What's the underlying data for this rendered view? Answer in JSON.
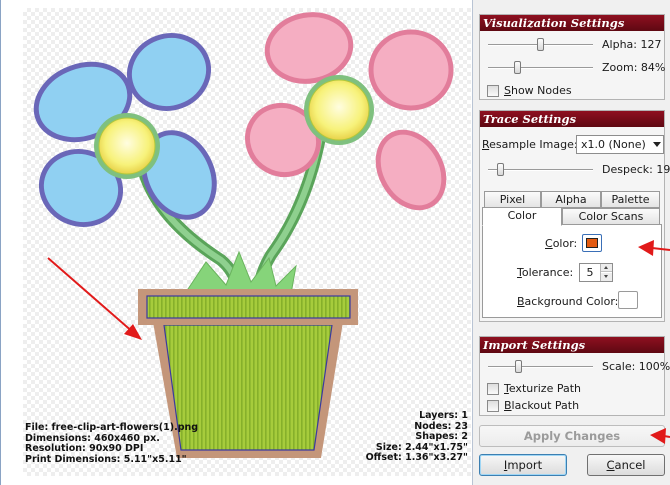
{
  "colors": {
    "panel_title_bg": "#8e1020",
    "annotation_arrow": "#e11a1a",
    "selected_trace_color": "#e35a10",
    "pot_fill": "#9cc53a",
    "pot_rim": "#c4967a",
    "petal_blue": "#8fd0f2",
    "petal_pink": "#f2a8be",
    "flower_center": "#f5f07a",
    "stem_green": "#7ac47a"
  },
  "canvas": {
    "file_info": {
      "file": "File: free-clip-art-flowers(1).png",
      "dimensions": "Dimensions: 460x460 px.",
      "resolution": "Resolution: 90x90 DPI",
      "print_dimensions": "Print Dimensions: 5.11\"x5.11\""
    },
    "trace_info": {
      "layers": "Layers: 1",
      "nodes": "Nodes: 23",
      "shapes": "Shapes: 2",
      "size": "Size: 2.44\"x1.75\"",
      "offset": "Offset: 1.36\"x3.27\""
    }
  },
  "visualization": {
    "title": "Visualization Settings",
    "alpha_label": "Alpha: 127",
    "alpha_value": 127,
    "alpha_max": 255,
    "zoom_label": "Zoom: 84%",
    "zoom_value": 84,
    "show_nodes_label": "Show Nodes",
    "show_nodes_checked": false
  },
  "trace": {
    "title": "Trace Settings",
    "resample_label": "Resample Image:",
    "resample_value": "x1.0 (None)",
    "despeck_label": "Despeck: 19",
    "despeck_value": 19,
    "tabs_row1": [
      "Pixel",
      "Alpha",
      "Palette"
    ],
    "tabs_row2": [
      "Color",
      "Color Scans"
    ],
    "active_tab": "Color",
    "color_label": "Color:",
    "tolerance_label": "Tolerance:",
    "tolerance_value": "5",
    "background_color_label": "Background Color:"
  },
  "import_settings": {
    "title": "Import Settings",
    "scale_label": "Scale: 100%",
    "scale_value": 100,
    "texturize_label": "Texturize Path",
    "texturize_checked": false,
    "blackout_label": "Blackout Path",
    "blackout_checked": false
  },
  "buttons": {
    "apply_changes": "Apply Changes",
    "import": "Import",
    "cancel": "Cancel"
  },
  "icons": [
    "dropdown-arrow-icon",
    "spin-up-icon",
    "spin-down-icon",
    "annotation-arrow-icon"
  ]
}
